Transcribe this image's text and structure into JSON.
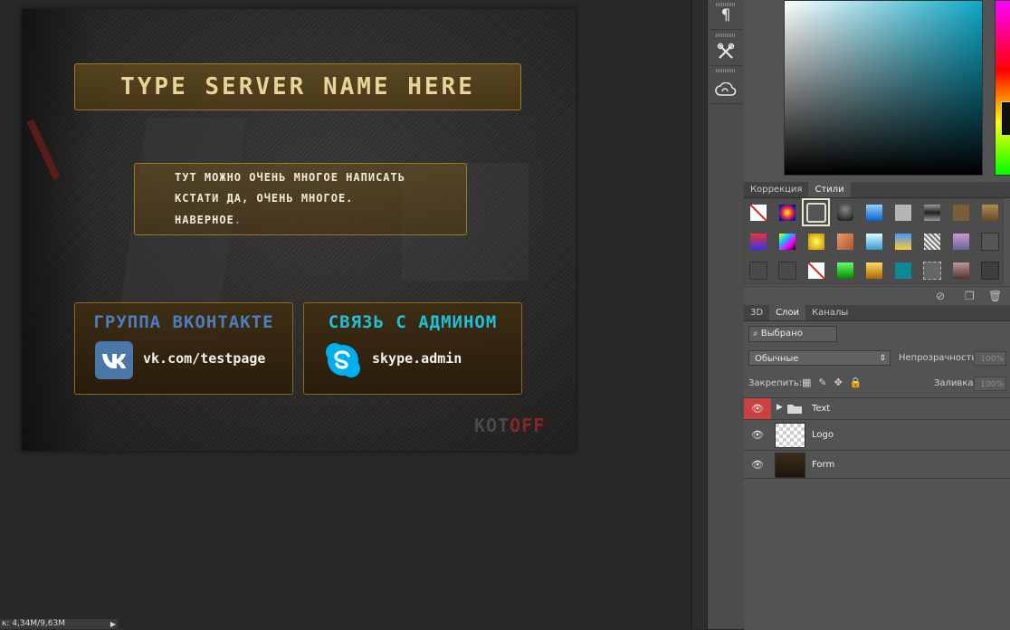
{
  "canvas": {
    "server_title": "TYPE SERVER NAME HERE",
    "message_lines": [
      "ТУТ МОЖНО ОЧЕНЬ МНОГОЕ НАПИСАТЬ",
      "КСТАТИ ДА, ОЧЕНЬ МНОГОЕ.",
      "НАВЕРНОЕ"
    ],
    "message_dot": ".",
    "vk_card": {
      "title": "ГРУППА ВКОНТАКТЕ",
      "handle": "vk.com/testpage",
      "icon": "vk-logo-icon"
    },
    "skype_card": {
      "title": "СВЯЗЬ С АДМИНОМ",
      "handle": "skype.admin",
      "icon": "skype-logo-icon"
    },
    "watermark_a": "KOT",
    "watermark_b": "OFF"
  },
  "status_bar": {
    "text": "к: 4,34M/9,63M",
    "arrow": "▶"
  },
  "dock": {
    "icons": [
      "paragraph-icon",
      "tools-icon",
      "creative-cloud-icon"
    ],
    "paragraph_glyph": "¶",
    "tools_glyph": "✂",
    "cloud_glyph": "☁"
  },
  "styles_panel": {
    "tabs": [
      "Коррекция",
      "Стили"
    ],
    "active_tab": "Стили"
  },
  "layers_panel": {
    "tabs": [
      "3D",
      "Слои",
      "Каналы"
    ],
    "active_tab": "Слои",
    "filter_label": "Выбрано",
    "blend_mode": "Обычные",
    "opacity_label": "Непрозрачность:",
    "opacity_value": "100%",
    "lock_label": "Закрепить:",
    "fill_label": "Заливка:",
    "fill_value": "100%",
    "layers": [
      {
        "name": "Text",
        "type": "group",
        "visible": true
      },
      {
        "name": "Logo",
        "type": "layer",
        "visible": true
      },
      {
        "name": "Form",
        "type": "layer",
        "visible": true
      }
    ]
  },
  "colors": {
    "accent_gold": "#e8d39a",
    "vk_blue": "#4c7fbf",
    "skype_cyan": "#1fc0d8",
    "eye_active_bg": "#c94242"
  }
}
